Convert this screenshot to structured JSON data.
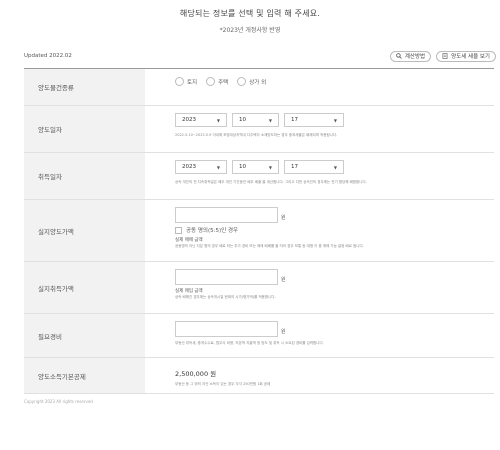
{
  "header": {
    "title": "해당되는 정보를 선택 및 입력 해 주세요.",
    "subtitle": "*2023년 개정사항 반영"
  },
  "topbar": {
    "updated": "Updated 2022.02",
    "calc_method": "계산방법",
    "view_tax": "양도세 세율 보기"
  },
  "rows": {
    "asset_type": {
      "label": "양도물건종류",
      "options": [
        "토지",
        "주택",
        "상가 외"
      ]
    },
    "transfer_date": {
      "label": "양도일자",
      "year": "2023",
      "month": "10",
      "day": "17",
      "note": "2022.5.10~2023.5.9 이내에 조정대상지역내 다주택자 소재양도하는 경우 중과세율은 배제되며 적용됩니다."
    },
    "acquire_date": {
      "label": "취득일자",
      "year": "2023",
      "month": "10",
      "day": "17",
      "note": "상속 개인의 전 지속취득일은 배우 개인 기간동안 배우 배출 을 계산합니다. 그리고 다만 상속인의 경우에는 전기 합당해 배합합니다."
    },
    "sale_price": {
      "label": "실지양도가액",
      "unit": "원",
      "joint_label": "공동 명의(5:5)인 경우",
      "hint": "실제 매매 금액",
      "hint_note": "공동명의 아닌 지분 협의 경우 배로 하는 추가 경비 또는 매매 배배를 볼 따라 경우 보통 등 대형 이 중 매매 가능 설정 배로 됩니다."
    },
    "purchase_price": {
      "label": "실지취득가액",
      "unit": "원",
      "hint": "실제 매입 금액",
      "hint_note": "상속 배해진 경우에는 상속개시일 현재의 시가(평가액)를 적용합니다."
    },
    "expenses": {
      "label": "필요경비",
      "unit": "원",
      "hint_note": "부동산 취득세, 중개수수료, 법무사 비용, 자본적 지출액 등 양도 및 취득 시 소요된 경비를 입력합니다."
    },
    "deduction": {
      "label": "양도소득기본공제",
      "amount": "2,500,000 원",
      "note": "부동산 등 그 밖의 자산 소득이 있는 경우 각각 250만원 1회 공제"
    }
  },
  "footer": {
    "text": "Copyright 2023 All rights reserved"
  }
}
